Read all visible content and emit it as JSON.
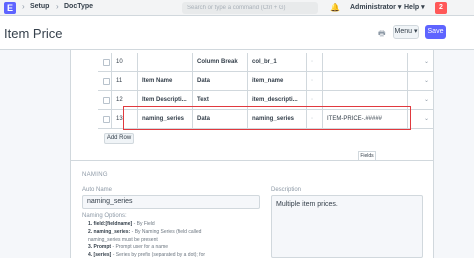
{
  "navbar": {
    "logo": "E",
    "breadcrumbs": [
      "Setup",
      "DocType"
    ],
    "search_placeholder": "Search or type a command (Ctrl + G)",
    "user": "Administrator",
    "help": "Help",
    "notifications": "2"
  },
  "page": {
    "title": "Item Price",
    "menu_label": "Menu",
    "save_label": "Save"
  },
  "fields_table": {
    "rows": [
      {
        "idx": "10",
        "label": "",
        "type": "Column Break",
        "name": "col_br_1",
        "options": ""
      },
      {
        "idx": "11",
        "label": "Item Name",
        "type": "Data",
        "name": "item_name",
        "options": ""
      },
      {
        "idx": "12",
        "label": "Item Descripti...",
        "type": "Text",
        "name": "item_descripti...",
        "options": ""
      },
      {
        "idx": "13",
        "label": "naming_series",
        "type": "Data",
        "name": "naming_series",
        "options": "ITEM-PRICE-.#####"
      }
    ],
    "add_row_label": "Add Row",
    "tooltip": "Fields"
  },
  "naming": {
    "section_title": "NAMING",
    "autoname_label": "Auto Name",
    "autoname_value": "naming_series",
    "naming_options_label": "Naming Options:",
    "options": [
      {
        "key": "1. field:[fieldname]",
        "text": " - By Field"
      },
      {
        "key": "2. naming_series:",
        "text": " - By Naming Series (field called"
      },
      {
        "key": "",
        "text": "naming_series must be present"
      },
      {
        "key": "3. Prompt",
        "text": " - Prompt user for a name"
      },
      {
        "key": "4. [series]",
        "text": " - Series by prefix (separated by a dot); for"
      }
    ],
    "description_label": "Description",
    "description_value": "Multiple item prices."
  }
}
